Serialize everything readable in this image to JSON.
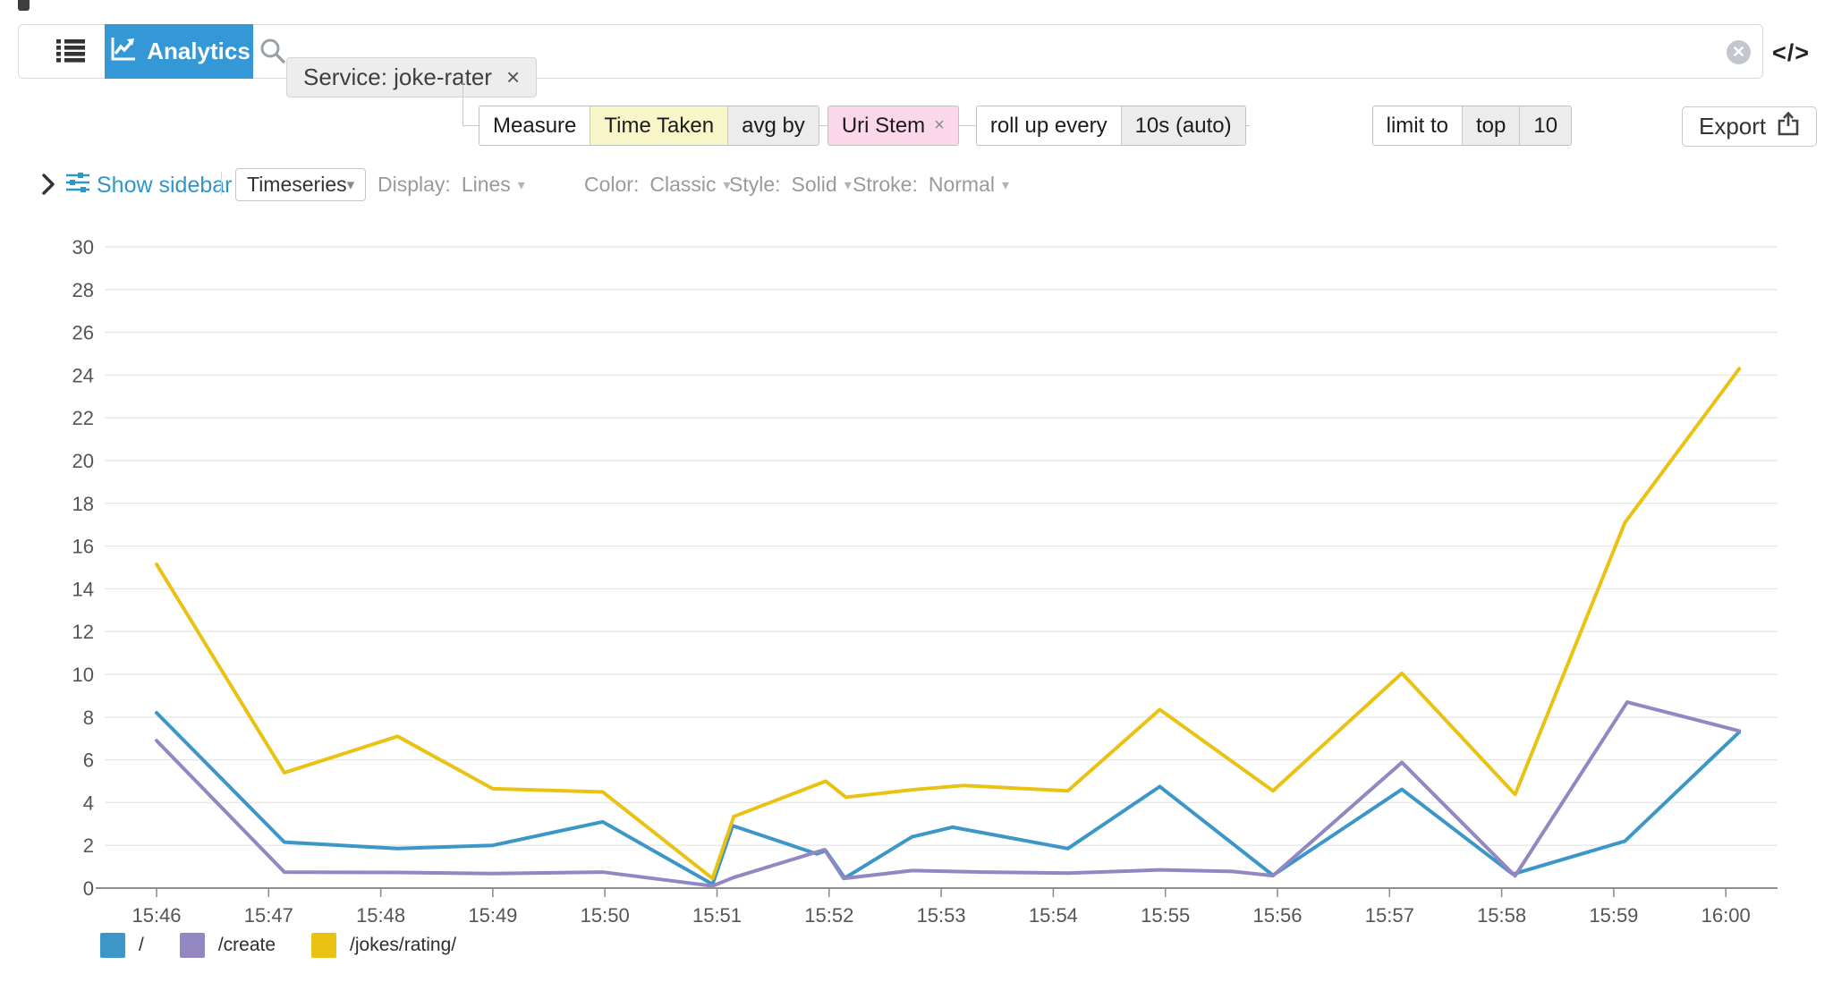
{
  "topbar": {
    "analytics_label": "Analytics",
    "filter_tag": "Service: joke-rater",
    "code_button": "</>"
  },
  "query": {
    "measure_label": "Measure",
    "measure_value": "Time Taken",
    "avg_by_label": "avg by",
    "avg_by_value": "Uri Stem",
    "rollup_label": "roll up every",
    "rollup_value": "10s (auto)",
    "limit_label": "limit to",
    "limit_mode": "top",
    "limit_value": "10",
    "export_label": "Export"
  },
  "controls": {
    "show_sidebar_label": "Show sidebar",
    "view_mode_value": "Timeseries",
    "display_label": "Display:",
    "display_value": "Lines",
    "color_label": "Color:",
    "color_value": "Classic",
    "style_label": "Style:",
    "style_value": "Solid",
    "stroke_label": "Stroke:",
    "stroke_value": "Normal"
  },
  "icons": {
    "caret": "▾",
    "tag_close": "×",
    "clear": "✕"
  },
  "colors": {
    "accent_blue": "#3498d6",
    "link_blue": "#3095c9",
    "pill_yellow": "#f8f6c9",
    "pill_pink": "#fad8e9",
    "pill_gray": "#ececec"
  },
  "chart_data": {
    "type": "line",
    "title": "",
    "xlabel": "",
    "ylabel": "",
    "x_unit": "minutes after 15:46",
    "x_ticks": [
      "15:46",
      "15:47",
      "15:48",
      "15:49",
      "15:50",
      "15:51",
      "15:52",
      "15:53",
      "15:54",
      "15:55",
      "15:56",
      "15:57",
      "15:58",
      "15:59",
      "16:00"
    ],
    "y_ticks": [
      0,
      2,
      4,
      6,
      8,
      10,
      12,
      14,
      16,
      18,
      20,
      22,
      24,
      26,
      28,
      30
    ],
    "ylim": [
      0,
      30
    ],
    "grid": true,
    "legend_position": "bottom",
    "series": [
      {
        "name": "/",
        "color": "#3c96c8",
        "points": [
          [
            0,
            8.2
          ],
          [
            1.14,
            2.15
          ],
          [
            2.15,
            1.85
          ],
          [
            3.0,
            2.0
          ],
          [
            3.98,
            3.1
          ],
          [
            4.96,
            0.18
          ],
          [
            5.14,
            2.92
          ],
          [
            5.89,
            1.6
          ],
          [
            5.97,
            1.75
          ],
          [
            6.14,
            0.47
          ],
          [
            6.74,
            2.4
          ],
          [
            7.1,
            2.85
          ],
          [
            8.13,
            1.85
          ],
          [
            8.95,
            4.75
          ],
          [
            9.96,
            0.6
          ],
          [
            11.11,
            4.62
          ],
          [
            12.1,
            0.65
          ],
          [
            13.1,
            2.2
          ],
          [
            14.12,
            7.3
          ]
        ]
      },
      {
        "name": "/create",
        "color": "#9387c2",
        "points": [
          [
            0,
            6.9
          ],
          [
            1.14,
            0.75
          ],
          [
            2.15,
            0.73
          ],
          [
            3.0,
            0.68
          ],
          [
            3.98,
            0.75
          ],
          [
            4.96,
            0.1
          ],
          [
            5.15,
            0.5
          ],
          [
            5.96,
            1.8
          ],
          [
            6.13,
            0.45
          ],
          [
            6.74,
            0.82
          ],
          [
            7.38,
            0.75
          ],
          [
            8.13,
            0.7
          ],
          [
            8.95,
            0.85
          ],
          [
            9.6,
            0.78
          ],
          [
            9.96,
            0.58
          ],
          [
            11.11,
            5.88
          ],
          [
            12.12,
            0.57
          ],
          [
            13.12,
            8.7
          ],
          [
            14.12,
            7.35
          ]
        ]
      },
      {
        "name": "/jokes/rating/",
        "color": "#eac213",
        "points": [
          [
            0,
            15.15
          ],
          [
            1.14,
            5.4
          ],
          [
            2.15,
            7.1
          ],
          [
            3.0,
            4.65
          ],
          [
            3.98,
            4.5
          ],
          [
            4.96,
            0.45
          ],
          [
            5.15,
            3.35
          ],
          [
            5.97,
            5.0
          ],
          [
            6.15,
            4.25
          ],
          [
            6.74,
            4.6
          ],
          [
            7.2,
            4.8
          ],
          [
            8.13,
            4.55
          ],
          [
            8.95,
            8.35
          ],
          [
            9.96,
            4.55
          ],
          [
            11.11,
            10.05
          ],
          [
            12.12,
            4.38
          ],
          [
            13.1,
            17.1
          ],
          [
            14.12,
            24.3
          ]
        ]
      }
    ]
  }
}
